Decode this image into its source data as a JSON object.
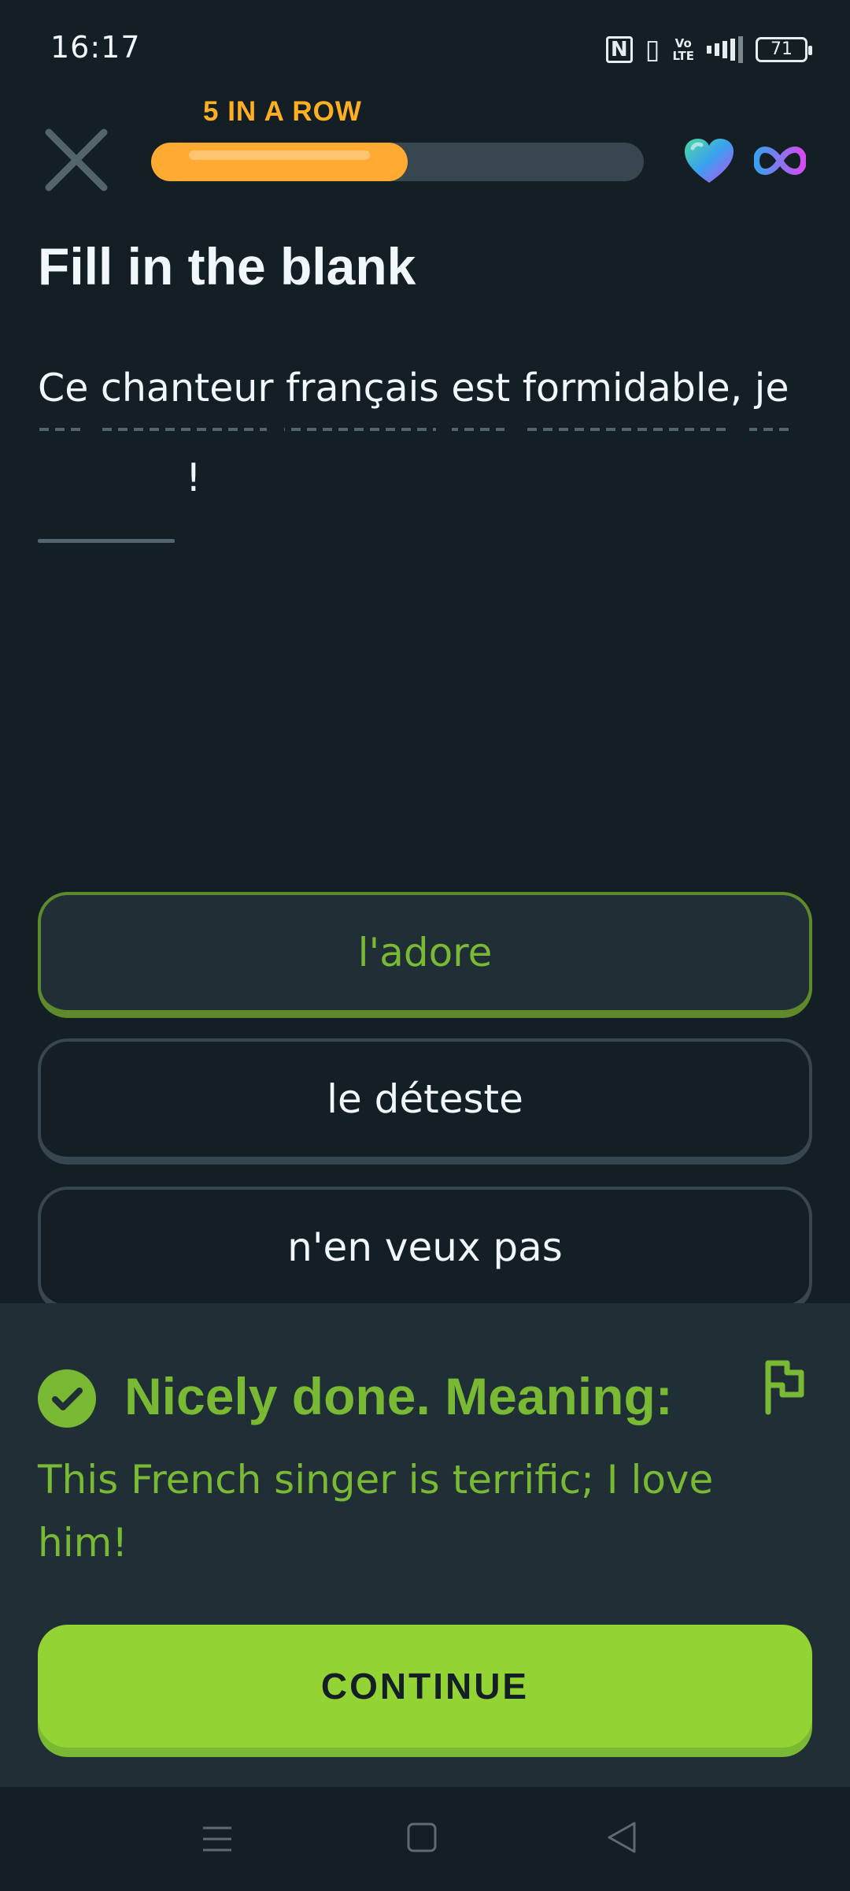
{
  "status_bar": {
    "time": "16:17",
    "battery": "71",
    "volte": "Vo\nLTE",
    "icons": [
      "nfc-icon",
      "vibrate-icon",
      "volte-icon",
      "lte-signal-icon",
      "battery-icon"
    ]
  },
  "lesson": {
    "streak_label": "5 IN A ROW",
    "progress": 0.52,
    "hearts": "∞"
  },
  "exercise": {
    "title": "Fill in the blank",
    "sentence": "Ce chanteur français est formidable, je",
    "sentence_end": "!"
  },
  "options": [
    {
      "label": "l'adore",
      "selected": true
    },
    {
      "label": "le déteste",
      "selected": false
    },
    {
      "label": "n'en veux pas",
      "selected": false
    }
  ],
  "feedback": {
    "heading": "Nicely done. Meaning:",
    "meaning": "This French singer is terrific; I love him!",
    "continue_label": "CONTINUE"
  },
  "colors": {
    "background": "#131f24",
    "panel": "#202f36",
    "accent_green": "#79b933",
    "button_green": "#93d333",
    "streak_orange": "#ffb020"
  }
}
